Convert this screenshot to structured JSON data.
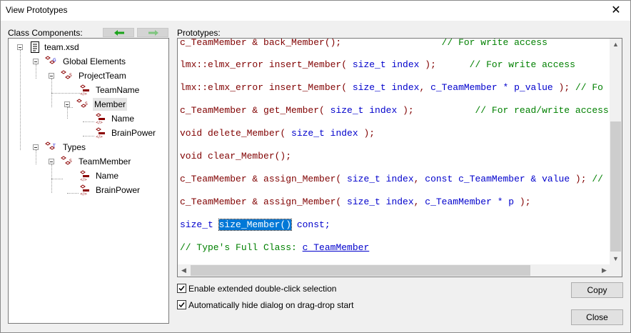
{
  "window": {
    "title": "View Prototypes"
  },
  "class_components": {
    "label": "Class Components:",
    "tree": {
      "root": "team.xsd",
      "global_elements": "Global Elements",
      "project_team": "ProjectTeam",
      "team_name": "TeamName",
      "member": "Member",
      "member_name": "Name",
      "member_brain_power": "BrainPower",
      "types": "Types",
      "team_member": "TeamMember",
      "tm_name": "Name",
      "tm_brain_power": "BrainPower"
    }
  },
  "prototypes": {
    "label": "Prototypes:",
    "lines": [
      {
        "parts": [
          {
            "t": "c_TeamMember & back_Member();",
            "c": "tx"
          },
          {
            "t": "                  // For write access",
            "c": "cm"
          }
        ]
      },
      {
        "parts": [
          {
            "t": "lmx::elmx_error insert_Member( ",
            "c": "tx"
          },
          {
            "t": "size_t index",
            "c": "kw"
          },
          {
            "t": " );",
            "c": "tx"
          },
          {
            "t": "      // For write access",
            "c": "cm"
          }
        ]
      },
      {
        "parts": [
          {
            "t": "lmx::elmx_error insert_Member( ",
            "c": "tx"
          },
          {
            "t": "size_t index",
            "c": "kw"
          },
          {
            "t": ", ",
            "c": "tx"
          },
          {
            "t": "c_TeamMember * p_value",
            "c": "kw"
          },
          {
            "t": " ); ",
            "c": "tx"
          },
          {
            "t": "// Fo",
            "c": "cm"
          }
        ]
      },
      {
        "parts": [
          {
            "t": "c_TeamMember & get_Member( ",
            "c": "tx"
          },
          {
            "t": "size_t index",
            "c": "kw"
          },
          {
            "t": " );",
            "c": "tx"
          },
          {
            "t": "           // For read/write access",
            "c": "cm"
          }
        ]
      },
      {
        "parts": [
          {
            "t": "void delete_Member( ",
            "c": "tx"
          },
          {
            "t": "size_t index",
            "c": "kw"
          },
          {
            "t": " );",
            "c": "tx"
          }
        ]
      },
      {
        "parts": [
          {
            "t": "void clear_Member();",
            "c": "tx"
          }
        ]
      },
      {
        "parts": [
          {
            "t": "c_TeamMember & assign_Member( ",
            "c": "tx"
          },
          {
            "t": "size_t index",
            "c": "kw"
          },
          {
            "t": ", ",
            "c": "tx"
          },
          {
            "t": "const c_TeamMember & value",
            "c": "kw"
          },
          {
            "t": " ); ",
            "c": "tx"
          },
          {
            "t": "//",
            "c": "cm"
          }
        ]
      },
      {
        "parts": [
          {
            "t": "c_TeamMember & assign_Member( ",
            "c": "tx"
          },
          {
            "t": "size_t index",
            "c": "kw"
          },
          {
            "t": ", ",
            "c": "tx"
          },
          {
            "t": "c_TeamMember * p",
            "c": "kw"
          },
          {
            "t": " );",
            "c": "tx"
          }
        ]
      },
      {
        "parts": [
          {
            "t": "size_t ",
            "c": "kw"
          },
          {
            "t": "size_Member()",
            "c": "hl"
          },
          {
            "t": " const;",
            "c": "kw"
          }
        ]
      },
      {
        "parts": [
          {
            "t": "// Type's Full Class: ",
            "c": "cm"
          },
          {
            "t": "c_TeamMember",
            "c": "lnk"
          }
        ]
      }
    ]
  },
  "options": {
    "extended_double_click": "Enable extended double-click selection",
    "auto_hide": "Automatically hide dialog on drag-drop start"
  },
  "buttons": {
    "copy": "Copy",
    "close": "Close"
  },
  "colors": {
    "keyword": "#0000cc",
    "text": "#800000",
    "comment": "#008000",
    "highlight": "#0078d7",
    "nav_arrow": "#1aa31a",
    "node_icon": "#8b0000"
  }
}
